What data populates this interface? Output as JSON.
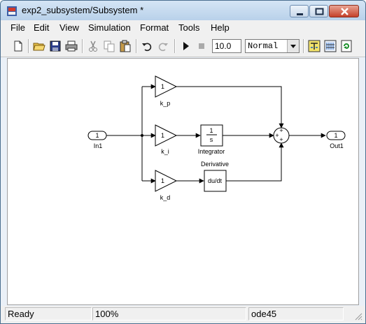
{
  "window": {
    "title": "exp2_subsystem/Subsystem *"
  },
  "menu": [
    "File",
    "Edit",
    "View",
    "Simulation",
    "Format",
    "Tools",
    "Help"
  ],
  "toolbar": {
    "stop_time": "10.0",
    "sim_mode": "Normal",
    "icons": [
      "new-icon",
      "open-icon",
      "save-icon",
      "print-icon",
      "cut-icon",
      "copy-icon",
      "paste-icon",
      "undo-icon",
      "redo-icon",
      "start-icon",
      "stop-icon",
      "library-browser-icon",
      "model-explorer-icon",
      "update-diagram-icon"
    ]
  },
  "diagram": {
    "in_port": {
      "number": "1",
      "label": "In1"
    },
    "out_port": {
      "number": "1",
      "label": "Out1"
    },
    "gain_p": {
      "value": "1",
      "label": "k_p"
    },
    "gain_i": {
      "value": "1",
      "label": "k_i"
    },
    "gain_d": {
      "value": "1",
      "label": "k_d"
    },
    "integrator": {
      "num": "1",
      "den": "s",
      "label": "Integrator"
    },
    "derivative": {
      "text": "du/dt",
      "label": "Derivative"
    },
    "sum_signs": [
      "+",
      "+",
      "+"
    ]
  },
  "status": {
    "state": "Ready",
    "zoom": "100%",
    "solver": "ode45"
  }
}
